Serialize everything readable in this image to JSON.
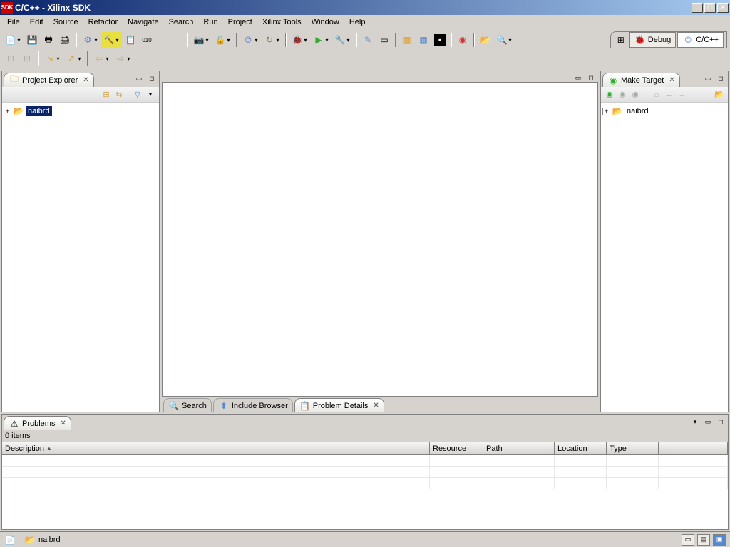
{
  "window": {
    "app_badge": "SDK",
    "title": "C/C++ - Xilinx SDK"
  },
  "menubar": [
    "File",
    "Edit",
    "Source",
    "Refactor",
    "Navigate",
    "Search",
    "Run",
    "Project",
    "Xilinx Tools",
    "Window",
    "Help"
  ],
  "perspectives": {
    "debug": "Debug",
    "cpp": "C/C++"
  },
  "project_explorer": {
    "title": "Project Explorer",
    "items": [
      {
        "name": "naibrd",
        "selected": true
      }
    ]
  },
  "make_target": {
    "title": "Make Target",
    "items": [
      {
        "name": "naibrd"
      }
    ]
  },
  "center_tabs": {
    "search": "Search",
    "include_browser": "Include Browser",
    "problem_details": "Problem Details"
  },
  "problems": {
    "title": "Problems",
    "count_label": "0 items",
    "columns": {
      "description": "Description",
      "resource": "Resource",
      "path": "Path",
      "location": "Location",
      "type": "Type"
    }
  },
  "statusbar": {
    "project": "naibrd"
  }
}
